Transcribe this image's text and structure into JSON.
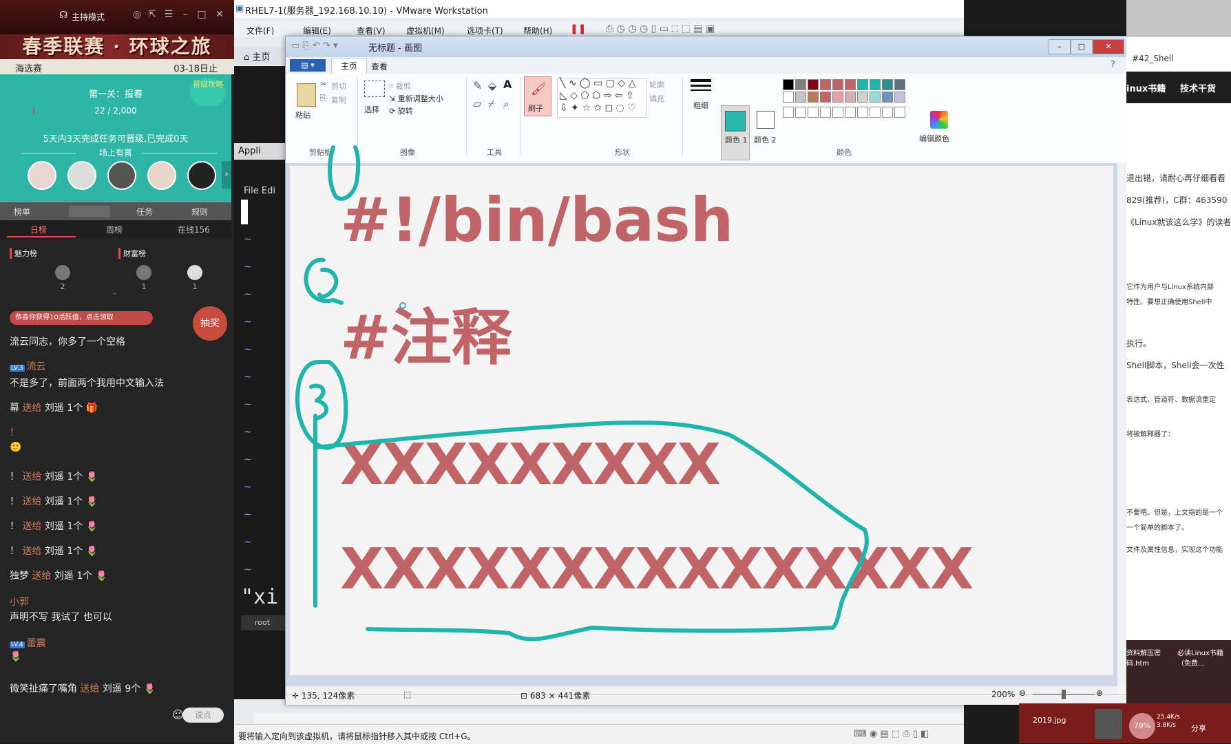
{
  "live_panel": {
    "header": {
      "mode": "主持模式"
    },
    "banner": {
      "title": "春季联赛 · 环球之旅"
    },
    "stage": {
      "left": "海选赛",
      "right": "03-18日止"
    },
    "task": {
      "title": "第一关：报春",
      "progress": "22 / 2,000",
      "note": "5天内3天完成任务可晋级,已完成0天",
      "sub": "场上有喜",
      "badge": "晋级攻略"
    },
    "tabs": [
      "榜单",
      "",
      "任务",
      "规则"
    ],
    "rank_tabs": {
      "daily": "日榜",
      "weekly": "周榜",
      "online": "在线156"
    },
    "ranks": {
      "charm": "魅力榜",
      "wealth": "财富榜",
      "counts": [
        "2",
        "1",
        "1"
      ]
    },
    "notice": "恭喜你获得10活跃值，点击领取",
    "draw_button": "抽奖",
    "chat": [
      {
        "text": "流云同志，你多了一个空格"
      },
      {
        "lv": "LV.3",
        "user": "流云"
      },
      {
        "text": "不是多了，前面两个我用中文输入法"
      },
      {
        "user": "幕",
        "gift_to": "送给",
        "text": "刘遥 1个"
      },
      {
        "text": "！"
      },
      {
        "user": "！",
        "gift_to": "送给",
        "text": "刘遥 1个"
      },
      {
        "user": "！",
        "gift_to": "送给",
        "text": "刘遥 1个"
      },
      {
        "user": "！",
        "gift_to": "送给",
        "text": "刘遥 1个"
      },
      {
        "user": "！",
        "gift_to": "送给",
        "text": "刘遥 1个"
      },
      {
        "user": "独梦",
        "gift_to": "送给",
        "text": "刘遥 1个"
      },
      {
        "user": "小郭"
      },
      {
        "text": "声明不写 我试了 也可以"
      },
      {
        "lv": "LV.4",
        "user": "蕾震"
      },
      {
        "user": "微笑扯痛了嘴角",
        "gift_to": "送给",
        "text": "刘遥 9个"
      }
    ],
    "input_placeholder": "说点"
  },
  "vmware": {
    "title": "RHEL7-1(服务器_192.168.10.10) - VMware Workstation",
    "menu": [
      "文件(F)",
      "编辑(E)",
      "查看(V)",
      "虚拟机(M)",
      "选项卡(T)",
      "帮助(H)"
    ],
    "home_tab": "主页",
    "guest": {
      "app_title": "Appli",
      "menu": "File  Edi",
      "xi_text": "\"xi",
      "task_label": "root"
    },
    "status_text": "要将输入定向到该虚拟机，请将鼠标指针移入其中或按 Ctrl+G。"
  },
  "paint": {
    "title": "无标题 - 画图",
    "tabs": {
      "home": "主页",
      "view": "查看"
    },
    "ribbon": {
      "clipboard": {
        "paste": "粘贴",
        "cut": "剪切",
        "copy": "复制",
        "label": "剪贴板"
      },
      "image": {
        "select": "选择",
        "crop": "裁剪",
        "resize": "重新调整大小",
        "rotate": "旋转",
        "label": "图像"
      },
      "tools": {
        "label": "工具"
      },
      "brush": {
        "label": "刷子"
      },
      "shapes": {
        "outline": "轮廓",
        "fill": "填充",
        "label": "形状"
      },
      "size": {
        "label": "粗细"
      },
      "color1": {
        "label": "颜色 1"
      },
      "color2": {
        "label": "颜色 2"
      },
      "colors": {
        "label": "颜色",
        "edit": "编辑颜色"
      }
    },
    "canvas_text": {
      "shebang": "#!/bin/bash",
      "comment": "#注释",
      "x1": "XXXXXXXXX",
      "x2": "XXXXXXXXXXXXXXX"
    },
    "handwritten_numbers": [
      "1",
      "2",
      "3"
    ],
    "status": {
      "cursor": "135, 124像素",
      "size": "683 × 441像素",
      "zoom": "200%"
    },
    "colors": {
      "text": "#c06468",
      "stroke": "#1fb5ad",
      "palette": [
        "#000000",
        "#7f7f7f",
        "#880015",
        "#c06468",
        "#c06468",
        "#c06468",
        "#1fb5ad",
        "#1fb5ad",
        "#2d8f8a",
        "#607080",
        "#ffffff",
        "#c3c3c3",
        "#b97a57",
        "#c06468",
        "#e8a0a4",
        "#d0b0b0",
        "#d0d0d0",
        "#9ad9d9",
        "#7092be",
        "#c8bfe7"
      ]
    }
  },
  "browser": {
    "tab_title": "#42_Shell",
    "nav": [
      "inux书籍",
      "技术干货"
    ],
    "lines": [
      "退出错，请耐心再仔细看看",
      "829(推荐)，C群：463590",
      "《Linux就该这么学》的读者",
      "它作为用户与Linux系统内部",
      "特性。要想正确使用Shell中",
      "执行。",
      "Shell脚本，Shell会一次性",
      "表达式、管道符、数据流重定",
      "将被解释器了：",
      "不要吧。但是，上文指的是一个",
      "一个简单的脚本了。",
      "文件及属性信息，实现这个功能"
    ],
    "desktop": {
      "file1": "资料解压密码.htm",
      "file2": "必读Linux书籍（免费...",
      "file3": "2019.jpg"
    },
    "net": {
      "badge": "79%",
      "up": "25.4K/s",
      "down": "3.8K/s",
      "share": "分享"
    }
  }
}
